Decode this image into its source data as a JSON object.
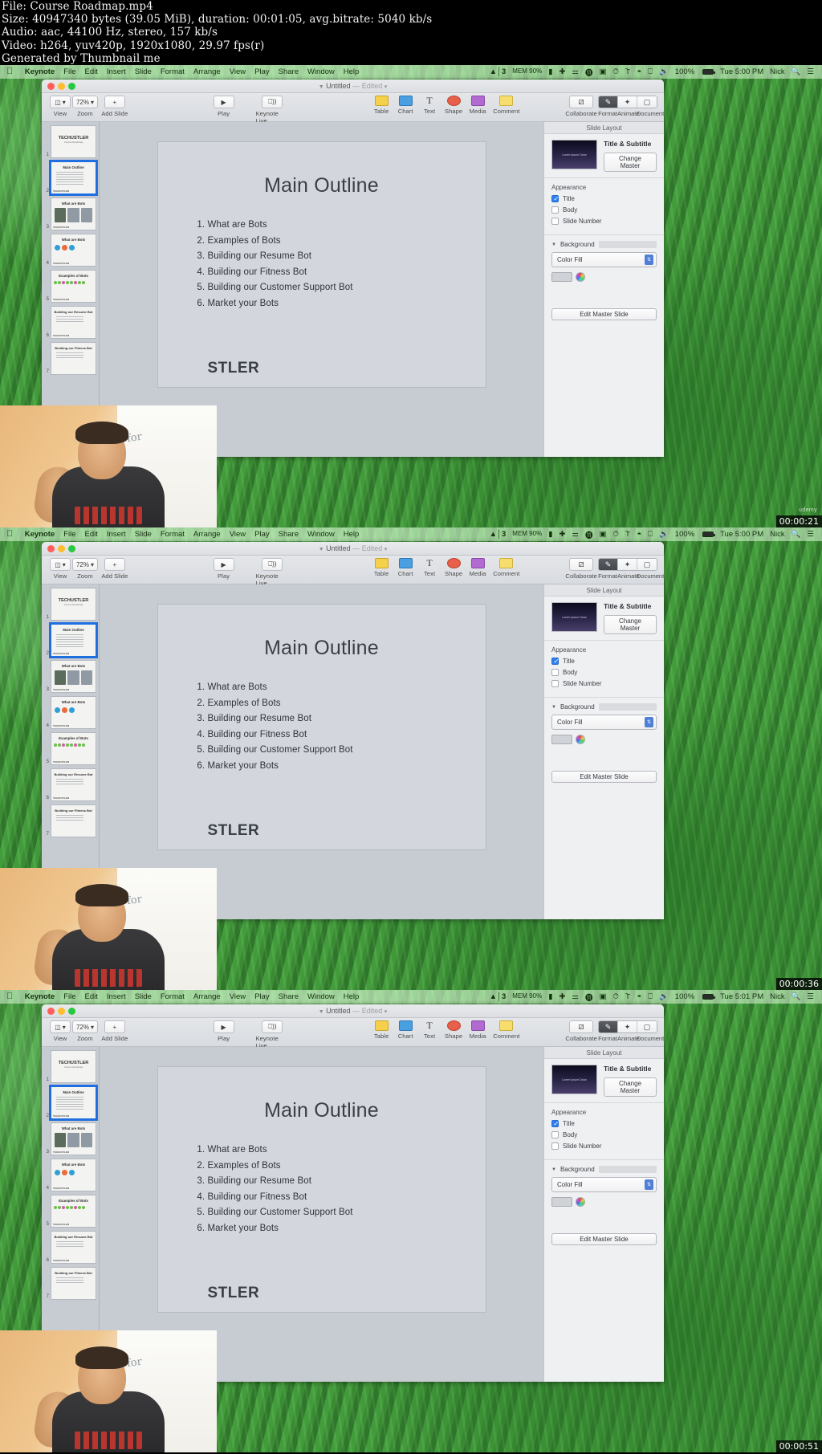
{
  "meta": {
    "line1": "File: Course Roadmap.mp4",
    "line2": "Size: 40947340 bytes (39.05 MiB), duration: 00:01:05, avg.bitrate: 5040 kb/s",
    "line3": "Audio: aac, 44100 Hz, stereo, 157 kb/s",
    "line4": "Video: h264, yuv420p, 1920x1080, 29.97 fps(r)",
    "line5": "Generated by Thumbnail me"
  },
  "menubar": {
    "apple_icon": "apple-icon",
    "items": [
      "Keynote",
      "File",
      "Edit",
      "Insert",
      "Slide",
      "Format",
      "Arrange",
      "View",
      "Play",
      "Share",
      "Window",
      "Help"
    ],
    "status": {
      "gfx": "3",
      "gfx_sub": "MEM 90%",
      "display_icon": "display-icon",
      "plug_icon": "power-plug-icon",
      "lock_icon": "lock-icon",
      "circle_icon": "do-not-disturb-icon",
      "record_icon": "record-icon",
      "clock_icon": "time-machine-icon",
      "bluetooth_icon": "bluetooth-icon",
      "wifi_icon": "wifi-icon",
      "airplay_icon": "airplay-icon",
      "volume_icon": "volume-icon",
      "battery_pct": "100%",
      "battery_icon": "battery-icon",
      "user": "Nick",
      "search_icon": "search-icon",
      "menu_icon": "control-center-icon"
    }
  },
  "window": {
    "title": "Untitled",
    "title_suffix": "— Edited",
    "toolbar": {
      "view_label": "View",
      "zoom_value": "72%",
      "zoom_label": "Zoom",
      "add_slide_glyph": "+",
      "add_slide_label": "Add Slide",
      "play_label": "Play",
      "keynote_live_label": "Keynote Live",
      "table_label": "Table",
      "chart_label": "Chart",
      "text_label": "Text",
      "text_glyph": "T",
      "shape_label": "Shape",
      "media_label": "Media",
      "comment_label": "Comment",
      "collaborate_label": "Collaborate",
      "format_label": "Format",
      "animate_label": "Animate",
      "document_label": "Document"
    }
  },
  "slide": {
    "title": "Main Outline",
    "items": [
      "What are Bots",
      "Examples of Bots",
      "Building our Resume Bot",
      "Building our Fitness Bot",
      "Building our Customer Support Bot",
      "Market your Bots"
    ],
    "logo": "STLER"
  },
  "thumbnails": [
    {
      "num": "1",
      "title": "TECHUSTLER",
      "sub": "Course Roadmap",
      "kind": "cover",
      "selected": false
    },
    {
      "num": "2",
      "title": "Main Outline",
      "sub": "",
      "kind": "list",
      "selected": true
    },
    {
      "num": "3",
      "title": "What are Bots",
      "sub": "",
      "kind": "blocks",
      "selected": false
    },
    {
      "num": "4",
      "title": "What are Bots",
      "sub": "",
      "kind": "dots",
      "selected": false
    },
    {
      "num": "5",
      "title": "Examples of Bots",
      "sub": "",
      "kind": "grid",
      "selected": false
    },
    {
      "num": "6",
      "title": "Building our Resume Bot",
      "sub": "",
      "kind": "list",
      "selected": false
    },
    {
      "num": "7",
      "title": "Building our Fitness Bot",
      "sub": "",
      "kind": "list",
      "selected": false
    }
  ],
  "inspector": {
    "header": "Slide Layout",
    "master_name": "Title & Subtitle",
    "master_thumb_text": "Lorem Ipsum Dolor",
    "change_master": "Change Master",
    "appearance_label": "Appearance",
    "checkboxes": [
      {
        "label": "Title",
        "checked": true
      },
      {
        "label": "Body",
        "checked": false
      },
      {
        "label": "Slide Number",
        "checked": false
      }
    ],
    "background_label": "Background",
    "fill_value": "Color Fill",
    "edit_master": "Edit Master Slide"
  },
  "frames": [
    {
      "timestamp": "00:00:21",
      "clock": "Tue 5:00 PM",
      "watermark": "udemy"
    },
    {
      "timestamp": "00:00:36",
      "clock": "Tue 5:00 PM",
      "watermark": ""
    },
    {
      "timestamp": "00:00:51",
      "clock": "Tue 5:01 PM",
      "watermark": ""
    }
  ],
  "colors": {
    "accent": "#1f6fe0",
    "desktop": "#3f8f38",
    "window_chrome": "#d7dae0"
  }
}
